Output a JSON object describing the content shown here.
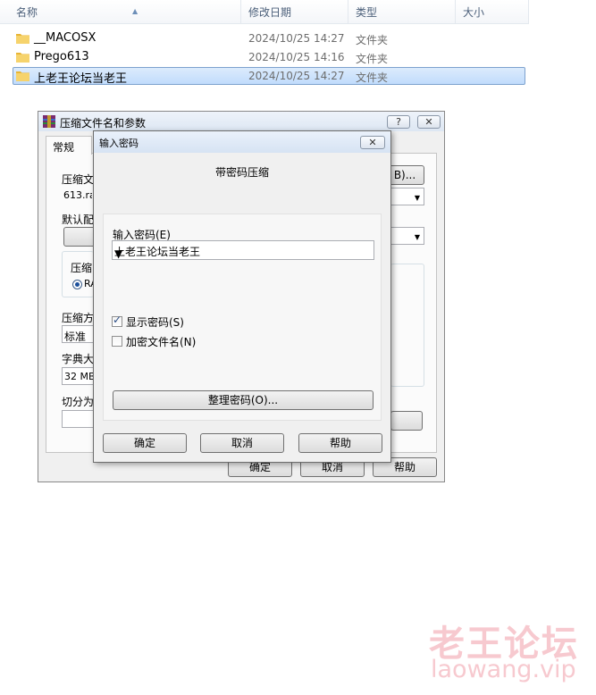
{
  "explorer": {
    "columns": {
      "name": "名称",
      "modified": "修改日期",
      "type": "类型",
      "size": "大小"
    },
    "rows": [
      {
        "name": "__MACOSX",
        "modified": "2024/10/25 14:27",
        "type": "文件夹"
      },
      {
        "name": "Prego613",
        "modified": "2024/10/25 14:16",
        "type": "文件夹"
      },
      {
        "name": "上老王论坛当老王",
        "modified": "2024/10/25 14:27",
        "type": "文件夹"
      }
    ]
  },
  "archive_dialog": {
    "title": "压缩文件名和参数",
    "help_caption": "?",
    "close_caption": "✕",
    "tab_general": "常规",
    "label_archive_name": "压缩文",
    "archive_name_value": "613.ra",
    "browse_button": "B)...",
    "label_default": "默认配",
    "label_format": "压缩",
    "format_option": "RA",
    "label_method": "压缩方",
    "method_value": "标准",
    "label_dict": "字典大",
    "dict_value": "32 MB",
    "label_split": "切分为",
    "ok_button": "确定",
    "cancel_button": "取消",
    "help_button": "帮助"
  },
  "password_dialog": {
    "title": "输入密码",
    "close_caption": "✕",
    "heading": "带密码压缩",
    "password_label": "输入密码(E)",
    "password_value": "上老王论坛当老王",
    "show_password_label": "显示密码(S)",
    "show_password_checked": true,
    "encrypt_filenames_label": "加密文件名(N)",
    "encrypt_filenames_checked": false,
    "organize_button": "整理密码(O)...",
    "ok_button": "确定",
    "cancel_button": "取消",
    "help_button": "帮助"
  },
  "watermark": {
    "text": "老王论坛",
    "url": "laowang.vip"
  },
  "colors": {
    "selection": "#cce4fc",
    "watermark": "#f7c9cf",
    "folder": "#e8b536"
  }
}
